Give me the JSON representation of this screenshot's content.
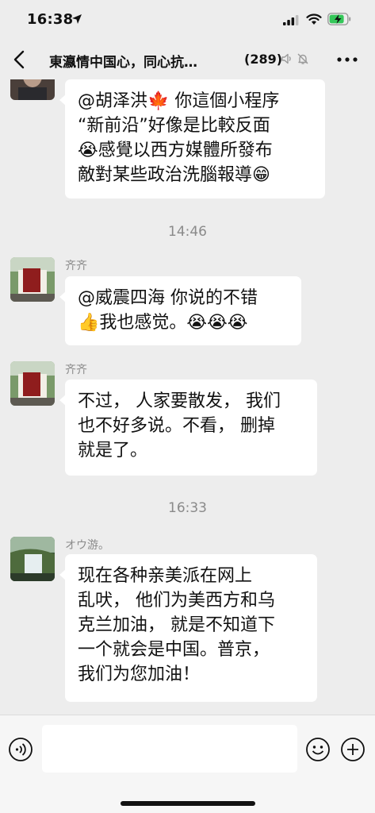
{
  "status_bar": {
    "time": "16:38"
  },
  "nav": {
    "title": "東瀛情中国心，同心抗…",
    "member_count": "(289)"
  },
  "messages": [
    {
      "text": "@胡泽洪🍁 你這個小程序“新前沿”好像是比較反面😭感覺以西方媒體所發布敵對某些政治洗腦報導😁"
    },
    {
      "timestamp": "14:46"
    },
    {
      "sender": "齐齐",
      "text": "@威震四海 你说的不错👍我也感觉。😭😭😭"
    },
    {
      "sender": "齐齐",
      "text": "不过， 人家要散发， 我们也不好多说。不看， 删掉就是了。"
    },
    {
      "timestamp": "16:33"
    },
    {
      "sender": "オウ游。",
      "text": "现在各种亲美派在网上乱吠， 他们为美西方和乌克兰加油， 就是不知道下一个就会是中国。普京， 我们为您加油！"
    }
  ],
  "msg1_lines": [
    "@胡泽洪🍁 你這個小程序",
    "“新前沿”好像是比較反面",
    "😭感覺以西方媒體所發布",
    "敵對某些政治洗腦報導😁"
  ],
  "msg2_lines": [
    "@威震四海 你说的不错",
    "👍我也感觉。😭😭😭"
  ],
  "msg3_lines": [
    "不过， 人家要散发， 我们",
    "也不好多说。不看， 删掉",
    "就是了。"
  ],
  "msg4_lines": [
    "现在各种亲美派在网上",
    "乱吠， 他们为美西方和乌",
    "克兰加油， 就是不知道下",
    "一个就会是中国。普京，",
    "我们为您加油！"
  ],
  "icons": {
    "back": "chevron-left-icon",
    "voice_off": "voice-off-icon",
    "mute": "bell-slash-icon",
    "more": "more-dots-icon",
    "voice_input": "voice-input-icon",
    "emoji": "emoji-icon",
    "plus": "plus-circle-icon"
  },
  "colors": {
    "background": "#ededed",
    "bubble": "#ffffff",
    "battery": "#34c759"
  }
}
